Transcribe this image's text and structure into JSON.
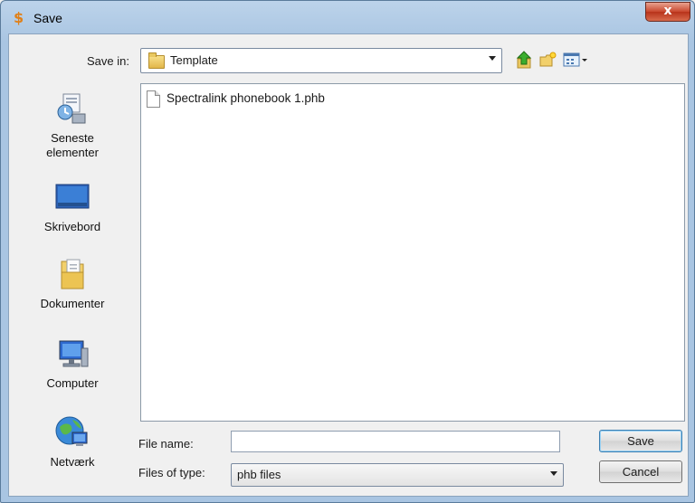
{
  "window": {
    "title": "Save",
    "close_glyph": "x"
  },
  "toolbar": {
    "save_in_label": "Save in:",
    "save_in_value": "Template",
    "icons": [
      "up-one-level-icon",
      "create-new-folder-icon",
      "view-menu-icon"
    ]
  },
  "places": [
    {
      "label_line1": "Seneste",
      "label_line2": "elementer",
      "icon": "recent-items-icon"
    },
    {
      "label_line1": "Skrivebord",
      "label_line2": "",
      "icon": "desktop-icon"
    },
    {
      "label_line1": "Dokumenter",
      "label_line2": "",
      "icon": "documents-icon"
    },
    {
      "label_line1": "Computer",
      "label_line2": "",
      "icon": "computer-icon"
    },
    {
      "label_line1": "Netværk",
      "label_line2": "",
      "icon": "network-icon"
    }
  ],
  "files": [
    {
      "name": "Spectralink phonebook 1.phb",
      "icon": "file-icon"
    }
  ],
  "form": {
    "file_name_label": "File name:",
    "file_name_value": "",
    "file_type_label": "Files of type:",
    "file_type_value": "phb files"
  },
  "buttons": {
    "save": "Save",
    "cancel": "Cancel"
  },
  "colors": {
    "title_bar": "#a9c5e2",
    "close_button": "#c9482e",
    "default_button_border": "#3c7fb1"
  }
}
